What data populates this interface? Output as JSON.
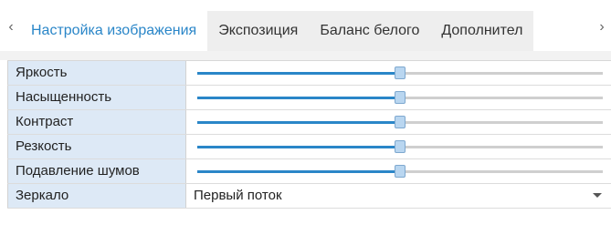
{
  "tabs": {
    "items": [
      {
        "label": "Настройка изображения"
      },
      {
        "label": "Экспозиция"
      },
      {
        "label": "Баланс белого"
      },
      {
        "label": "Дополнител"
      }
    ]
  },
  "settings": {
    "sliders": [
      {
        "label": "Яркость",
        "value_fraction": 0.5
      },
      {
        "label": "Насыщенность",
        "value_fraction": 0.5
      },
      {
        "label": "Контраст",
        "value_fraction": 0.5
      },
      {
        "label": "Резкость",
        "value_fraction": 0.5
      },
      {
        "label": "Подавление шумов",
        "value_fraction": 0.5
      }
    ],
    "mirror": {
      "label": "Зеркало",
      "value": "Первый поток"
    }
  },
  "colors": {
    "accent": "#2a86c8",
    "label_bg": "#dde9f6",
    "track": "#cfcfcf"
  }
}
